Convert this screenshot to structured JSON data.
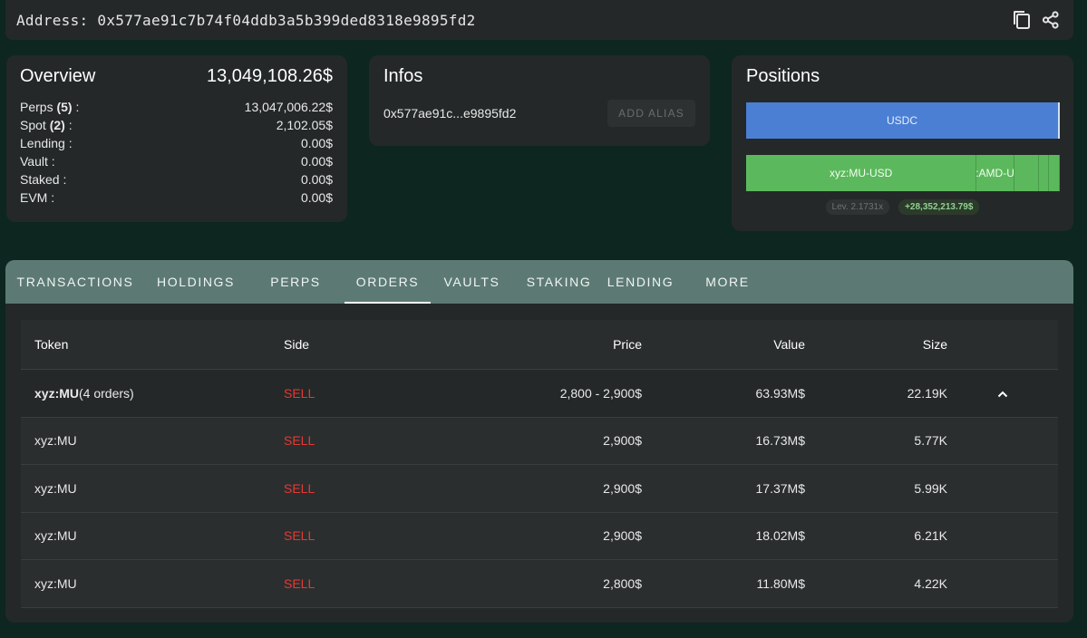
{
  "header": {
    "address": "Address: 0x577ae91c7b74f04ddb3a5b399ded8318e9895fd2",
    "copy_icon": "copy-icon",
    "share_icon": "share-icon"
  },
  "overview": {
    "title": "Overview",
    "total": "13,049,108.26$",
    "rows": [
      {
        "label": "Perps",
        "count": "(5)",
        "suffix": " :",
        "value": "13,047,006.22$"
      },
      {
        "label": "Spot",
        "count": "(2)",
        "suffix": " :",
        "value": "2,102.05$"
      },
      {
        "label": "Lending :",
        "count": "",
        "suffix": "",
        "value": "0.00$"
      },
      {
        "label": "Vault :",
        "count": "",
        "suffix": "",
        "value": "0.00$"
      },
      {
        "label": "Staked :",
        "count": "",
        "suffix": "",
        "value": "0.00$"
      },
      {
        "label": "EVM :",
        "count": "",
        "suffix": "",
        "value": "0.00$"
      }
    ]
  },
  "infos": {
    "title": "Infos",
    "short_address": "0x577ae91c...e9895fd2",
    "alias_button": "ADD ALIAS"
  },
  "positions": {
    "title": "Positions",
    "spot_bar": {
      "label": "USDC",
      "color": "#4a7fd4"
    },
    "perp_segments": [
      {
        "label": "xyz:MU-USD",
        "share": 0.735
      },
      {
        "label": ":AMD-U",
        "share": 0.12
      },
      {
        "label": "",
        "share": 0.08
      },
      {
        "label": "",
        "share": 0.03
      },
      {
        "label": "",
        "share": 0.035
      }
    ],
    "perp_color": "#5cb85c",
    "leverage": "Lev. 2.1731x",
    "pnl": "+28,352,213.79$"
  },
  "tabs": [
    {
      "label": "TRANSACTIONS",
      "active": false
    },
    {
      "label": "HOLDINGS",
      "active": false
    },
    {
      "label": "PERPS",
      "active": false
    },
    {
      "label": "ORDERS",
      "active": true
    },
    {
      "label": "VAULTS",
      "active": false
    },
    {
      "label": "STAKING",
      "active": false
    },
    {
      "label": "LENDING",
      "active": false
    },
    {
      "label": "MORE",
      "active": false
    }
  ],
  "orders": {
    "columns": {
      "token": "Token",
      "side": "Side",
      "price": "Price",
      "value": "Value",
      "size": "Size"
    },
    "group": {
      "token": "xyz:MU",
      "count": "(4 orders)",
      "side": "SELL",
      "price": "2,800 - 2,900$",
      "value": "63.93M$",
      "size": "22.19K"
    },
    "rows": [
      {
        "token": "xyz:MU",
        "side": "SELL",
        "price": "2,900$",
        "value": "16.73M$",
        "size": "5.77K"
      },
      {
        "token": "xyz:MU",
        "side": "SELL",
        "price": "2,900$",
        "value": "17.37M$",
        "size": "5.99K"
      },
      {
        "token": "xyz:MU",
        "side": "SELL",
        "price": "2,900$",
        "value": "18.02M$",
        "size": "6.21K"
      },
      {
        "token": "xyz:MU",
        "side": "SELL",
        "price": "2,800$",
        "value": "11.80M$",
        "size": "4.22K"
      }
    ]
  },
  "colors": {
    "background": "#0e2620",
    "card": "#252828",
    "tabbar": "#5c7a73",
    "sell": "#e53935"
  }
}
